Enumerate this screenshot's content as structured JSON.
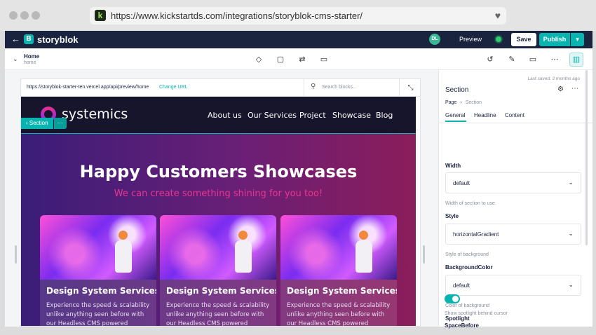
{
  "browser": {
    "url": "https://www.kickstartds.com/integrations/storyblok-cms-starter/",
    "favicon_letter": "k"
  },
  "topnav": {
    "brand": "storyblok",
    "brand_letter": "B",
    "avatar_initials": "DL",
    "preview_label": "Preview",
    "save_label": "Save",
    "publish_label": "Publish"
  },
  "toolbar": {
    "story_title": "Home",
    "story_slug": "home"
  },
  "preview": {
    "url": "https://storyblok-starter-ten.vercel.app/api/preview/home",
    "change_url": "Change URL",
    "search_placeholder": "Search blocks..."
  },
  "site": {
    "logo": "systemics",
    "nav": [
      "About us",
      "Our Services",
      "Project",
      "Showcase",
      "Blog"
    ],
    "section_tag": "Section",
    "hero_title": "Happy Customers Showcases",
    "hero_subtitle": "We can create something shining for you too!",
    "cards": [
      {
        "title": "Design System Services",
        "text": "Experience the speed & scalability unlike anything seen before with our Headless CMS powered"
      },
      {
        "title": "Design System Services",
        "text": "Experience the speed & scalability unlike anything seen before with our Headless CMS powered"
      },
      {
        "title": "Design System Services",
        "text": "Experience the speed & scalability unlike anything seen before with our Headless CMS powered"
      }
    ]
  },
  "panel": {
    "last_saved": "Last saved: 2 months ago",
    "title": "Section",
    "breadcrumb_parent": "Page",
    "breadcrumb_current": "Section",
    "tabs": [
      "General",
      "Headline",
      "Content"
    ],
    "fields": {
      "width": {
        "label": "Width",
        "value": "default",
        "help": "Width of section to use"
      },
      "style": {
        "label": "Style",
        "value": "horizontalGradient",
        "help": "Style of background"
      },
      "background_color": {
        "label": "BackgroundColor",
        "value": "default",
        "help": "Color of background"
      },
      "spotlight": {
        "label": "Spotlight",
        "help": "Show spotlight behind cursor",
        "enabled": true
      },
      "space_before": {
        "label": "SpaceBefore"
      }
    }
  },
  "colors": {
    "accent": "#09b3af",
    "nav_bg": "#1b243f",
    "hero_subtitle": "#e9358f"
  }
}
